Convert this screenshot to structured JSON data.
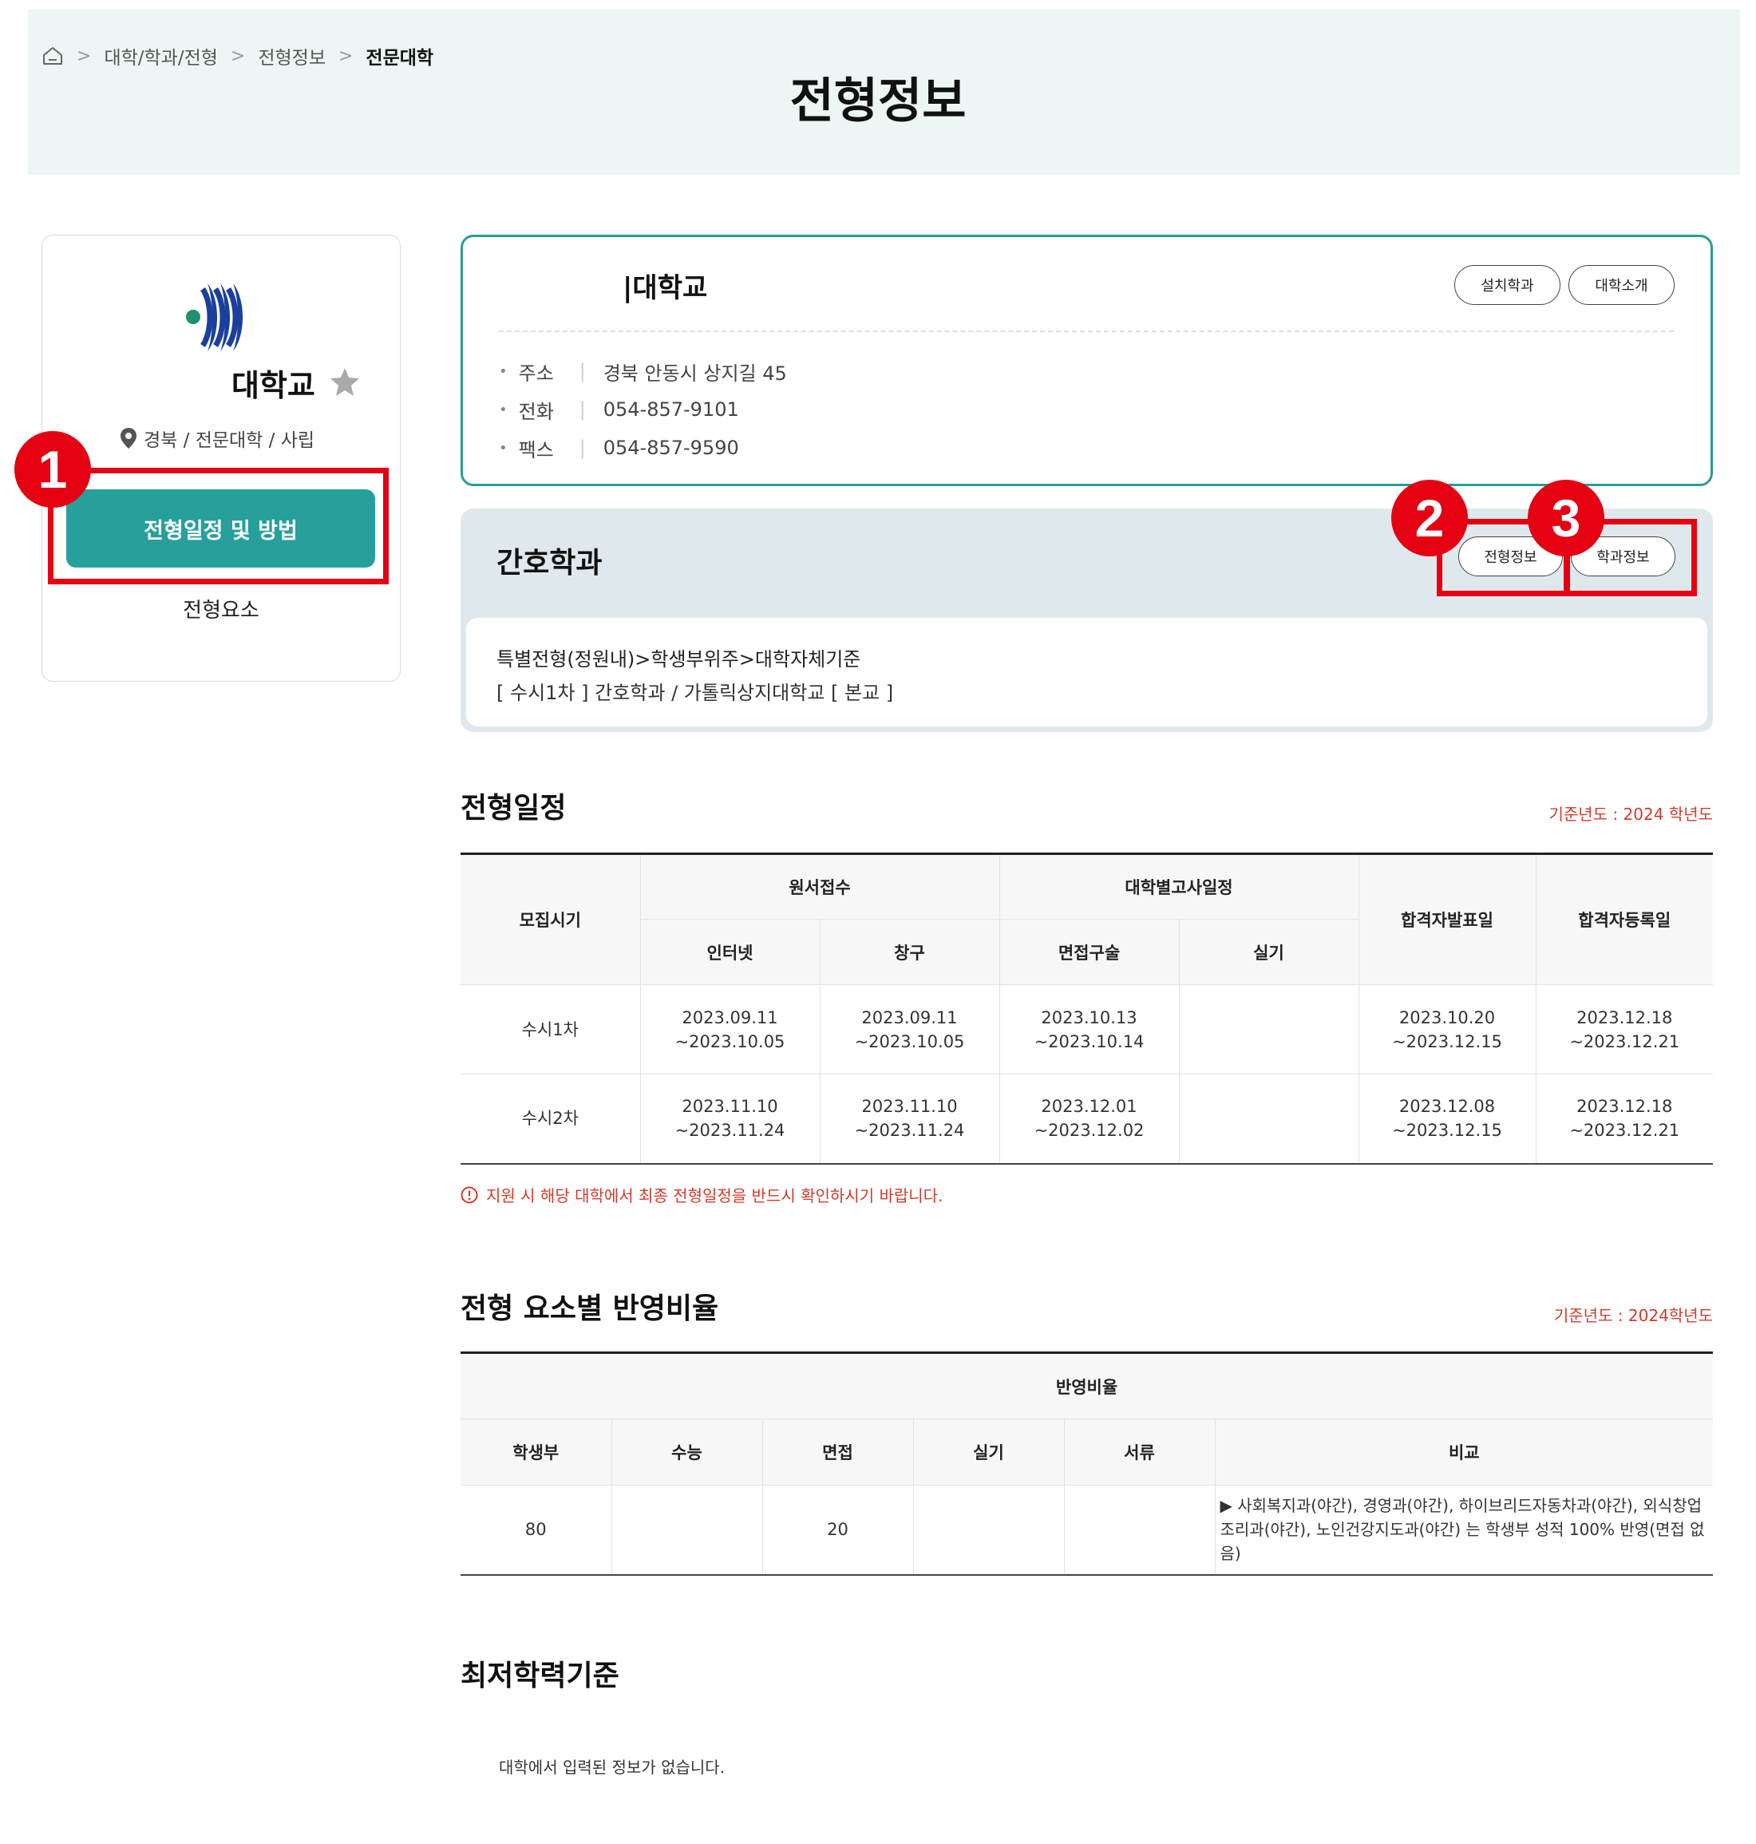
{
  "breadcrumb": {
    "items": [
      "대학/학과/전형",
      "전형정보",
      "전문대학"
    ]
  },
  "page_title": "전형정보",
  "sidebar": {
    "university_name": "대학교",
    "location": "경북 / 전문대학 / 사립",
    "primary_button": "전형일정 및 방법",
    "secondary_link": "전형요소"
  },
  "annotations": [
    "1",
    "2",
    "3"
  ],
  "school_info": {
    "title": "|대학교",
    "buttons": [
      "설치학과",
      "대학소개"
    ],
    "rows": [
      {
        "label": "주소",
        "value": "경북 안동시 상지길 45"
      },
      {
        "label": "전화",
        "value": "054-857-9101"
      },
      {
        "label": "팩스",
        "value": "054-857-9590"
      }
    ]
  },
  "department": {
    "title": "간호학과",
    "buttons": [
      "전형정보",
      "학과정보"
    ],
    "line1": "특별전형(정원내)>학생부위주>대학자체기준",
    "line2": "[ 수시1차 ] 간호학과 / 가톨릭상지대학교 [ 본교 ]"
  },
  "schedule": {
    "title": "전형일정",
    "note": "기준년도 : 2024 학년도",
    "header": {
      "period": "모집시기",
      "application": "원서접수",
      "exam": "대학별고사일정",
      "announce": "합격자발표일",
      "register": "합격자등록일",
      "internet": "인터넷",
      "window": "창구",
      "interview": "면접구술",
      "practical": "실기"
    },
    "rows": [
      {
        "period": "수시1차",
        "internet": [
          "2023.09.11",
          "~2023.10.05"
        ],
        "window": [
          "2023.09.11",
          "~2023.10.05"
        ],
        "interview": [
          "2023.10.13",
          "~2023.10.14"
        ],
        "practical": "",
        "announce": [
          "2023.10.20",
          "~2023.12.15"
        ],
        "register": [
          "2023.12.18",
          "~2023.12.21"
        ]
      },
      {
        "period": "수시2차",
        "internet": [
          "2023.11.10",
          "~2023.11.24"
        ],
        "window": [
          "2023.11.10",
          "~2023.11.24"
        ],
        "interview": [
          "2023.12.01",
          "~2023.12.02"
        ],
        "practical": "",
        "announce": [
          "2023.12.08",
          "~2023.12.15"
        ],
        "register": [
          "2023.12.18",
          "~2023.12.21"
        ]
      }
    ],
    "warning": "지원 시 해당 대학에서 최종 전형일정을 반드시 확인하시기 바랍니다."
  },
  "ratio": {
    "title": "전형 요소별 반영비율",
    "note": "기준년도 : 2024학년도",
    "group_header": "반영비율",
    "columns": [
      "학생부",
      "수능",
      "면접",
      "실기",
      "서류",
      "비교"
    ],
    "row": [
      "80",
      "",
      "20",
      "",
      "",
      "▶ 사회복지과(야간), 경영과(야간), 하이브리드자동차과(야간), 외식창업조리과(야간), 노인건강지도과(야간) 는 학생부 성적 100% 반영(면접 없음)"
    ]
  },
  "min_standard": {
    "title": "최저학력기준",
    "empty_message": "대학에서 입력된 정보가 없습니다."
  },
  "colors": {
    "accent": "#27a09b",
    "header_bg": "#edf6f4",
    "dept_bg": "#dfe9ed",
    "annotation_red": "#e50012",
    "note_red": "#d23b2a"
  }
}
